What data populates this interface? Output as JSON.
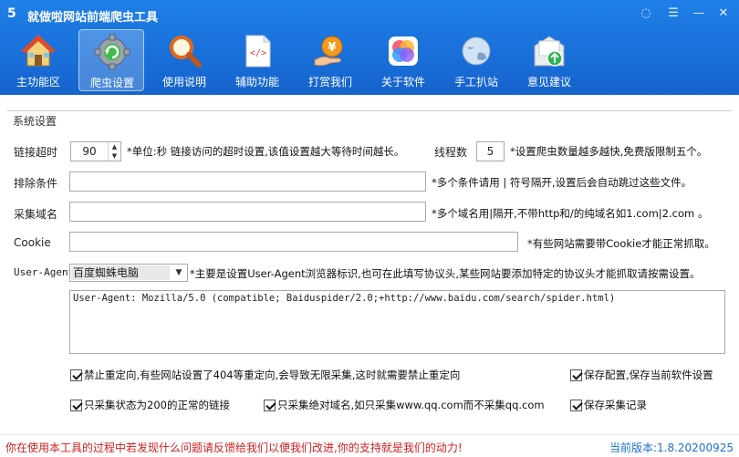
{
  "app": {
    "logo_char": "5",
    "title": "就做啦网站前端爬虫工具"
  },
  "window_controls": {
    "skin": "◌",
    "menu": "☰",
    "minimize": "—",
    "close": "✕"
  },
  "toolbar": {
    "items": [
      {
        "label": "主功能区",
        "icon": "home-icon"
      },
      {
        "label": "爬虫设置",
        "icon": "gear-refresh-icon",
        "active": true
      },
      {
        "label": "使用说明",
        "icon": "magnifier-icon"
      },
      {
        "label": "辅助功能",
        "icon": "code-document-icon"
      },
      {
        "label": "打赏我们",
        "icon": "yen-hand-icon"
      },
      {
        "label": "关于软件",
        "icon": "app-colors-icon"
      },
      {
        "label": "手工扒站",
        "icon": "globe-icon"
      },
      {
        "label": "意见建议",
        "icon": "mail-upload-icon"
      }
    ]
  },
  "settings": {
    "group_title": "系统设置",
    "timeout": {
      "label": "链接超时",
      "value": "90",
      "hint": "*单位:秒 链接访问的超时设置,该值设置越大等待时间越长。"
    },
    "threads": {
      "label": "线程数",
      "value": "5",
      "hint": "*设置爬虫数量越多越快,免费版限制五个。"
    },
    "exclude": {
      "label": "排除条件",
      "value": "",
      "hint": "*多个条件请用 | 符号隔开,设置后会自动跳过这些文件。"
    },
    "domain": {
      "label": "采集域名",
      "value": "",
      "hint": "*多个域名用|隔开,不带http和/的纯域名如1.com|2.com 。"
    },
    "cookie": {
      "label": "Cookie",
      "value": "",
      "hint": "*有些网站需要带Cookie才能正常抓取。"
    },
    "user_agent": {
      "label": "User-Agent",
      "selected": "百度蜘蛛电脑",
      "hint": "*主要是设置User-Agent浏览器标识,也可在此填写协议头,某些网站要添加特定的协议头才能抓取请按需设置。",
      "text": "User-Agent: Mozilla/5.0 (compatible; Baiduspider/2.0;+http://www.baidu.com/search/spider.html)"
    },
    "checkboxes": {
      "no_redirect": {
        "label": "禁止重定向,有些网站设置了404等重定向,会导致无限采集,这时就需要禁止重定向",
        "checked": true
      },
      "save_config": {
        "label": "保存配置,保存当前软件设置",
        "checked": true
      },
      "only_200": {
        "label": "只采集状态为200的正常的链接",
        "checked": true
      },
      "absolute_domain": {
        "label": "只采集绝对域名,如只采集www.qq.com而不采集qq.com",
        "checked": true
      },
      "save_log": {
        "label": "保存采集记录",
        "checked": true
      }
    }
  },
  "status": {
    "message": "你在使用本工具的过程中若发现什么问题请反馈给我们以便我们改进,你的支持就是我们的动力!",
    "version": "当前版本:1.8.20200925"
  },
  "colors": {
    "header_blue": "#1a70da",
    "status_red": "#d21f1f",
    "version_blue": "#1a6fd4"
  }
}
